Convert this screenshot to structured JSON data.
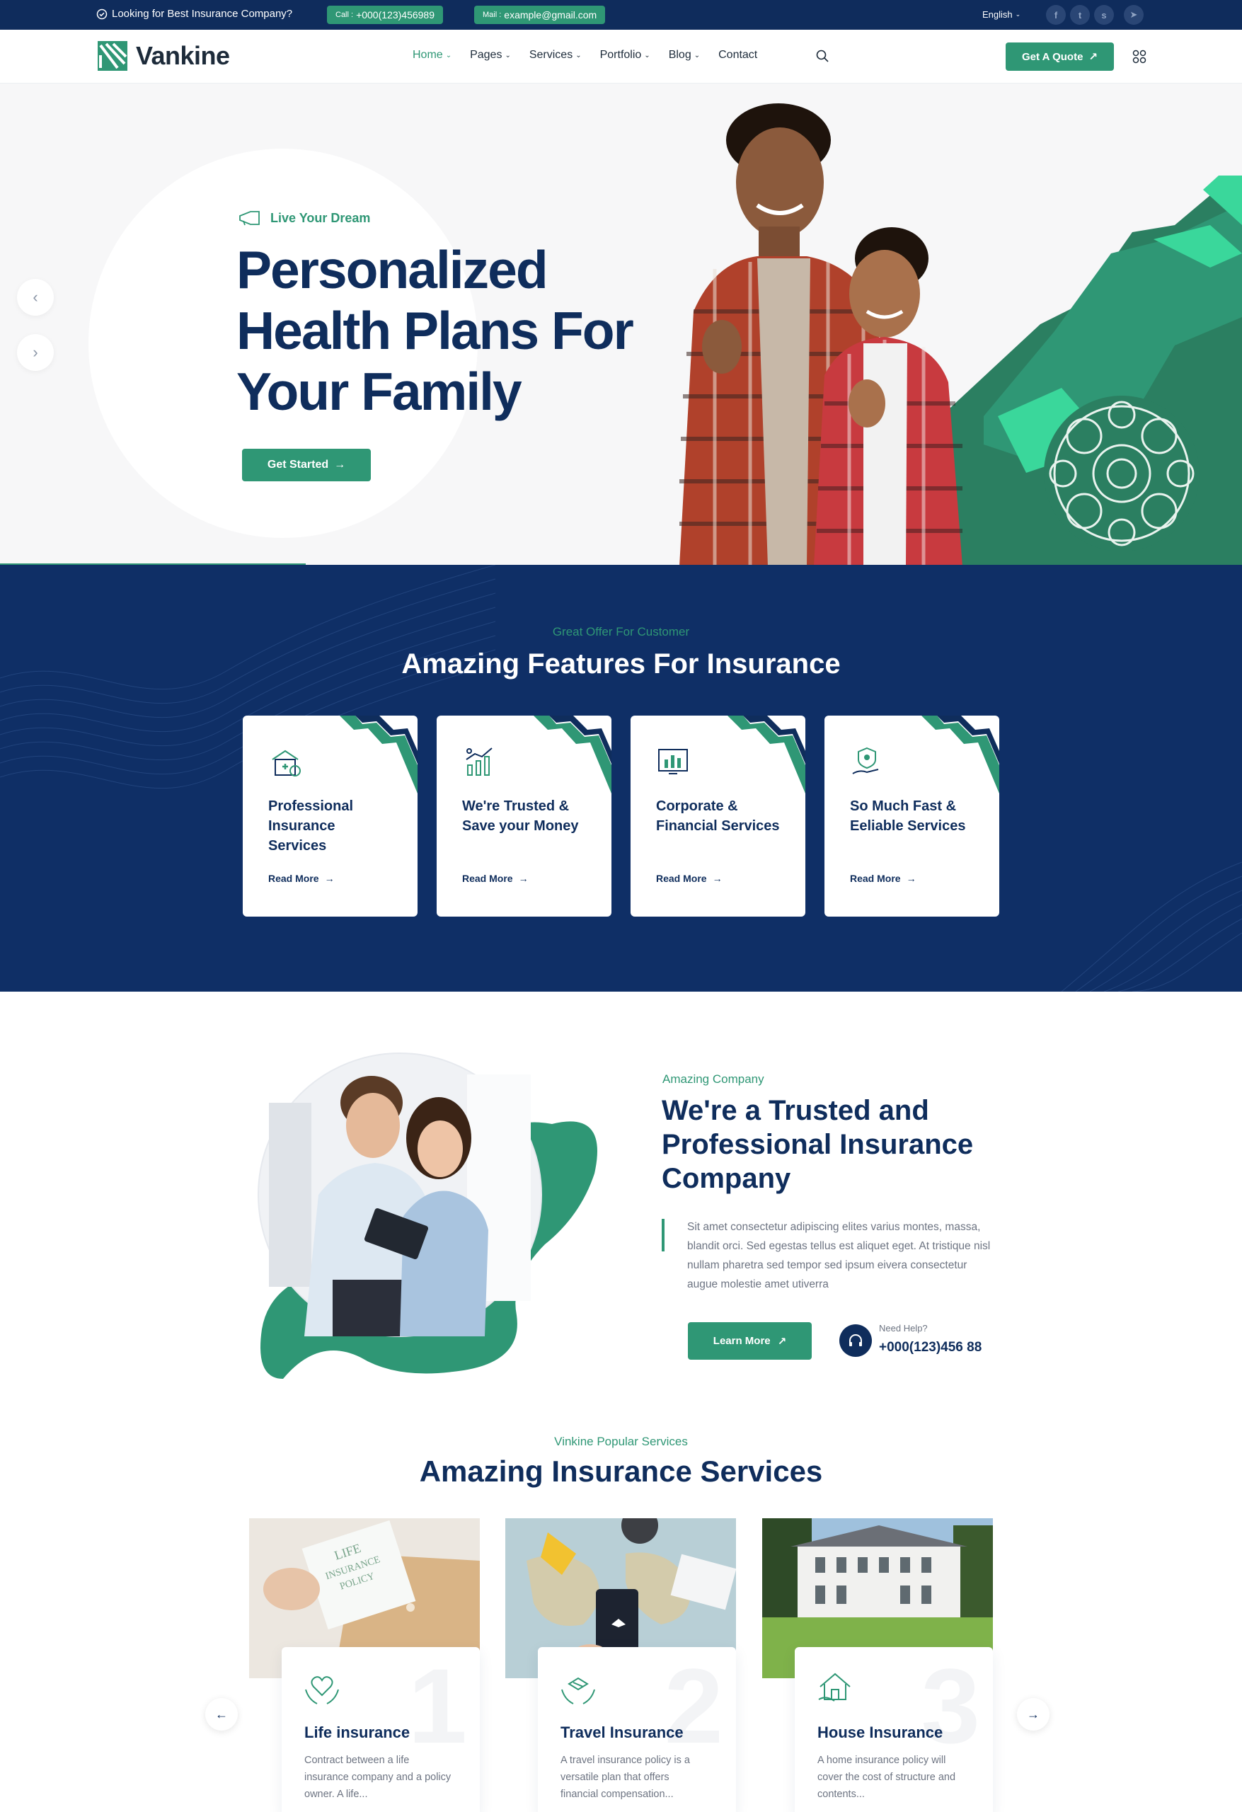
{
  "topbar": {
    "tagline": "Looking for Best Insurance Company?",
    "call_prefix": "Call :",
    "call_value": "+000(123)456989",
    "mail_prefix": "Mail :",
    "mail_value": "example@gmail.com",
    "language": "English",
    "social": [
      "facebook-icon",
      "twitter-icon",
      "skype-icon",
      "telegram-icon"
    ]
  },
  "nav": {
    "brand": "Vankine",
    "menu": [
      {
        "label": "Home",
        "dropdown": true,
        "active": true
      },
      {
        "label": "Pages",
        "dropdown": true
      },
      {
        "label": "Services",
        "dropdown": true
      },
      {
        "label": "Portfolio",
        "dropdown": true
      },
      {
        "label": "Blog",
        "dropdown": true
      },
      {
        "label": "Contact",
        "dropdown": false
      }
    ],
    "quote_label": "Get A Quote"
  },
  "hero": {
    "subtitle": "Live Your Dream",
    "title_line1": "Personalized",
    "title_line2": "Health Plans For",
    "title_line3": "Your Family",
    "button": "Get Started"
  },
  "features": {
    "subtitle": "Great Offer For Customer",
    "title": "Amazing Features For Insurance",
    "cards": [
      {
        "title": "Professional Insurance Services",
        "link": "Read More",
        "icon": "health-insurance-icon"
      },
      {
        "title": "We're Trusted & Save your Money",
        "link": "Read More",
        "icon": "growth-chart-icon"
      },
      {
        "title": "Corporate & Financial Services",
        "link": "Read More",
        "icon": "financial-report-icon"
      },
      {
        "title": "So Much Fast & Eeliable Services",
        "link": "Read More",
        "icon": "shield-hand-icon"
      }
    ]
  },
  "about": {
    "subtitle": "Amazing Company",
    "title": "We're a Trusted and Professional Insurance Company",
    "text": "Sit amet consectetur adipiscing elites varius montes, massa, blandit orci. Sed egestas tellus est aliquet eget. At tristique nisl nullam pharetra sed tempor sed ipsum eivera consectetur augue molestie amet utiverra",
    "button": "Learn More",
    "help_label": "Need Help?",
    "help_phone": "+000(123)456 88"
  },
  "services": {
    "subtitle": "Vinkine Popular Services",
    "title": "Amazing Insurance Services",
    "cards": [
      {
        "num": "1",
        "title": "Life insurance",
        "text": "Contract between a life insurance company and a policy owner. A life...",
        "icon": "heart-hands-icon",
        "image_text_line1": "LIFE",
        "image_text_line2": "INSURANCE",
        "image_text_line3": "POLICY"
      },
      {
        "num": "2",
        "title": "Travel Insurance",
        "text": "A travel insurance policy is a versatile plan that offers financial compensation...",
        "icon": "airplane-hands-icon"
      },
      {
        "num": "3",
        "title": "House Insurance",
        "text": "A home insurance policy will cover the cost of structure and contents...",
        "icon": "house-icon"
      }
    ]
  },
  "colors": {
    "navy": "#0f2d5c",
    "green": "#2f9775",
    "light_green": "#3ad79b"
  }
}
